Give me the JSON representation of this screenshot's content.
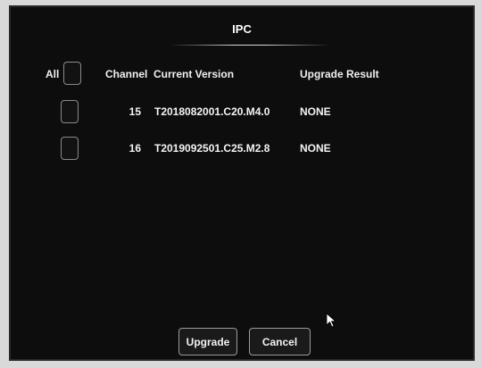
{
  "dialog": {
    "title": "IPC"
  },
  "header": {
    "all_label": "All",
    "channel": "Channel",
    "current_version": "Current Version",
    "upgrade_result": "Upgrade Result"
  },
  "rows": [
    {
      "channel": "15",
      "version": "T2018082001.C20.M4.0",
      "result": "NONE"
    },
    {
      "channel": "16",
      "version": "T2019092501.C25.M2.8",
      "result": "NONE"
    }
  ],
  "buttons": {
    "upgrade": "Upgrade",
    "cancel": "Cancel"
  },
  "colors": {
    "background": "#0d0d0d",
    "text": "#f2f2f2",
    "border": "#8a8a8a"
  }
}
